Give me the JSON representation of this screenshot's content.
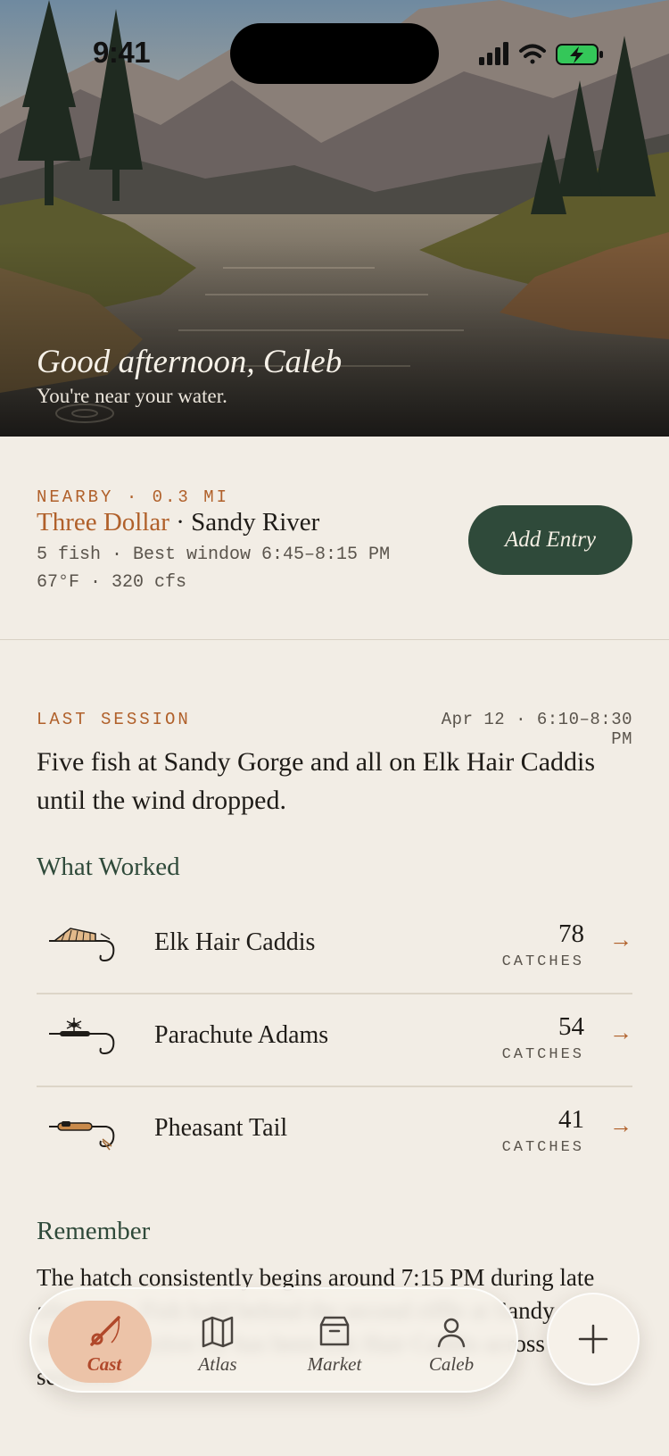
{
  "status_bar": {
    "time": "9:41"
  },
  "hero": {
    "greeting": "Good afternoon, Caleb",
    "subtitle": "You're near your water."
  },
  "nearby": {
    "eyebrow": "NEARBY · 0.3 MI",
    "spot_name": "Three Dollar",
    "separator": " · ",
    "river": "Sandy River",
    "line1": "5 fish · Best window 6:45–8:15 PM",
    "line2": "67°F · 320 cfs",
    "add_entry_label": "Add Entry"
  },
  "last_session": {
    "label": "LAST SESSION",
    "date": "Apr 12 · 6:10–8:30 PM",
    "summary": "Five fish at Sandy Gorge and all on Elk Hair Caddis until the wind dropped."
  },
  "what_worked": {
    "title": "What Worked",
    "flies": [
      {
        "name": "Elk Hair Caddis",
        "count": "78",
        "unit": "CATCHES",
        "arrow": "→",
        "icon": "elk-hair-caddis-fly-icon"
      },
      {
        "name": "Parachute Adams",
        "count": "54",
        "unit": "CATCHES",
        "arrow": "→",
        "icon": "parachute-adams-fly-icon"
      },
      {
        "name": "Pheasant Tail",
        "count": "41",
        "unit": "CATCHES",
        "arrow": "→",
        "icon": "pheasant-tail-fly-icon"
      }
    ]
  },
  "remember": {
    "title": "Remember",
    "text": "The hatch consistently begins around 7:15 PM during late afternoon. Fish hold behind the second riffle at Sandy Gorge. Most productive fly has been Elk Hair Caddis across 15 sessions."
  },
  "tabbar": {
    "tabs": [
      {
        "label": "Cast",
        "icon": "fishing-rod-icon",
        "active": true
      },
      {
        "label": "Atlas",
        "icon": "map-icon",
        "active": false
      },
      {
        "label": "Market",
        "icon": "shop-box-icon",
        "active": false
      },
      {
        "label": "Caleb",
        "icon": "person-icon",
        "active": false
      }
    ],
    "plus_icon": "plus-icon"
  },
  "colors": {
    "background": "#f2ede5",
    "accent_rust": "#b0602a",
    "forest_green": "#2f4a3a",
    "active_tab_pill": "#ecc3a8"
  }
}
